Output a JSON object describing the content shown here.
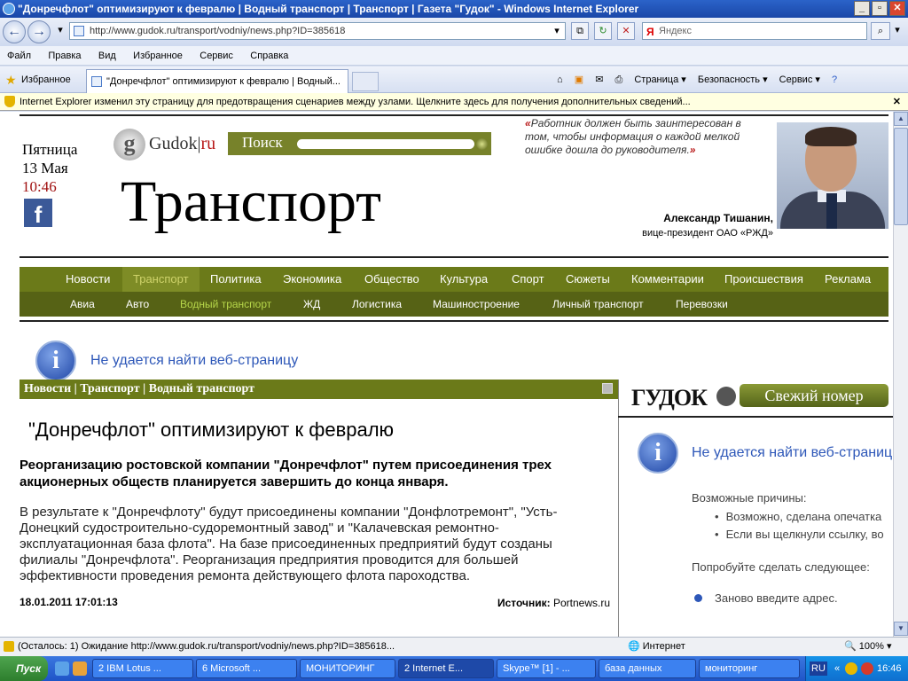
{
  "window": {
    "title": "\"Донречфлот\" оптимизируют к февралю | Водный транспорт | Транспорт | Газета \"Гудок\" - Windows Internet Explorer"
  },
  "addressbar": {
    "url": "http://www.gudok.ru/transport/vodniy/news.php?ID=385618",
    "search_placeholder": "Яндекс",
    "search_brand": "Я"
  },
  "menu": [
    "Файл",
    "Правка",
    "Вид",
    "Избранное",
    "Сервис",
    "Справка"
  ],
  "tabs": {
    "favorites": "Избранное",
    "active_tab": "\"Донречфлот\" оптимизируют к февралю | Водный...",
    "tools": [
      "Страница ▾",
      "Безопасность ▾",
      "Сервис ▾"
    ]
  },
  "infobar": "Internet Explorer изменил эту страницу для предотвращения сценариев между узлами.  Щелкните здесь для получения дополнительных сведений...",
  "page": {
    "weekday": "Пятница",
    "date": "13 Мая",
    "time": "10:46",
    "logo": {
      "g": "g",
      "name": "Gudok",
      "tld": "ru"
    },
    "search_label": "Поиск",
    "section_title": "Транспорт",
    "quote_open": "«",
    "quote": "Работник должен быть заинтересован в том, чтобы информация о каждой мелкой ошибке дошла до руководителя.",
    "quote_close": "»",
    "person_name": "Александр Тишанин,",
    "person_role": "вице-президент ОАО «РЖД»",
    "nav_main": [
      "Новости",
      "Транспорт",
      "Политика",
      "Экономика",
      "Общество",
      "Культура",
      "Спорт",
      "Сюжеты",
      "Комментарии",
      "Происшествия",
      "Реклама"
    ],
    "nav_sub": [
      "Авиа",
      "Авто",
      "Водный транспорт",
      "ЖД",
      "Логистика",
      "Машиностроение",
      "Личный транспорт",
      "Перевозки"
    ],
    "error_title": "Не удается найти веб-страницу",
    "breadcrumb": "Новости | Транспорт | Водный транспорт",
    "headline": "\"Донречфлот\" оптимизируют к февралю",
    "lead": "Реорганизацию ростовской компании \"Донречфлот\" путем присоединения трех акционерных обществ планируется завершить до конца января.",
    "body": "В результате к \"Донречфлоту\" будут присоединены компании \"Донфлотремонт\", \"Усть-Донецкий судостроительно-судоремонтный завод\" и \"Калачевская ремонтно-эксплуатационная база флота\". На базе присоединенных предприятий будут созданы филиалы \"Донречфлота\". Реорганизация предприятия проводится для большей эффективности проведения ремонта действующего флота пароходства.",
    "pubdate": "18.01.2011 17:01:13",
    "source_label": "Источник:",
    "source": "Portnews.ru",
    "gudok_label": "ГУДОК",
    "fresh_issue": "Свежий номер",
    "error2_title": "Не удается найти веб-страниц",
    "reasons_header": "Возможные причины:",
    "reasons": [
      "Возможно, сделана опечатка",
      "Если вы щелкнули ссылку, во"
    ],
    "try_header": "Попробуйте сделать следующее:",
    "retry": "Заново введите адрес."
  },
  "status": {
    "text": "(Осталось: 1) Ожидание http://www.gudok.ru/transport/vodniy/news.php?ID=385618...",
    "zone": "Интернет",
    "zoom": "100%"
  },
  "taskbar": {
    "start": "Пуск",
    "tasks": [
      "2 IBM Lotus ...",
      "6 Microsoft ...",
      "МОНИТОРИНГ",
      "2 Internet E...",
      "Skype™ [1] - ...",
      "база данных",
      "мониторинг"
    ],
    "lang": "RU",
    "clock": "16:46"
  }
}
